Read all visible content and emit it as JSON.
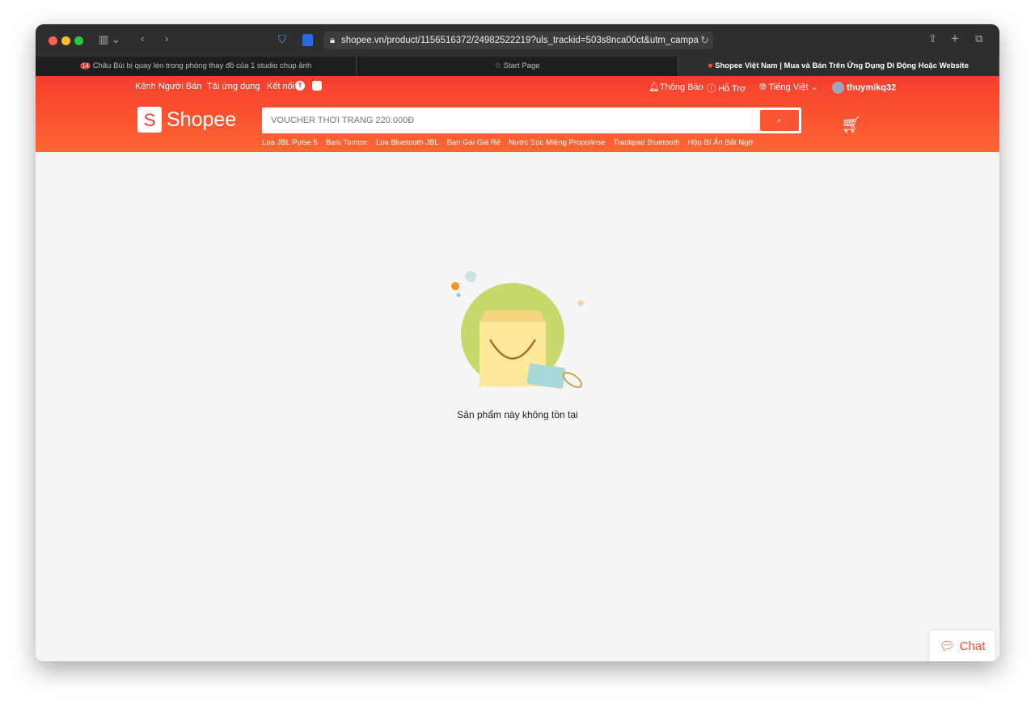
{
  "browser": {
    "url": "shopee.vn/product/1156516372/24982522219?uls_trackid=503s8nca00ct&utm_campa",
    "tabs": [
      {
        "label": "Châu Bùi bị quay lén trong phòng thay đồ của 1 studio chụp ảnh",
        "favicon": "14"
      },
      {
        "label": "Start Page"
      },
      {
        "label": "Shopee Việt Nam | Mua và Bán Trên Ứng Dụng Di Động Hoặc Website"
      }
    ]
  },
  "header": {
    "seller": "Kênh Người Bán",
    "app": "Tải ứng dụng",
    "connect": "Kết nối",
    "notifications": "Thông Báo",
    "help": "Hỗ Trợ",
    "language": "Tiếng Việt",
    "username": "thuymikq32",
    "logo": "Shopee",
    "search_placeholder": "VOUCHER THỜI TRANG 220.000Đ",
    "suggestions": [
      "Loa JBL Pulse 5",
      "Balo Tomtoc",
      "Loa Bluetooth JBL",
      "Bạn Gái Giá Rẻ",
      "Nước Súc Miệng Propolinse",
      "Trackpad Bluetooth",
      "Hộp Bí Ẩn Bất Ngờ"
    ]
  },
  "main": {
    "message": "Sản phẩm này không tồn tại"
  },
  "chat": {
    "label": "Chat"
  },
  "colors": {
    "brand": "#ee4d2d"
  }
}
